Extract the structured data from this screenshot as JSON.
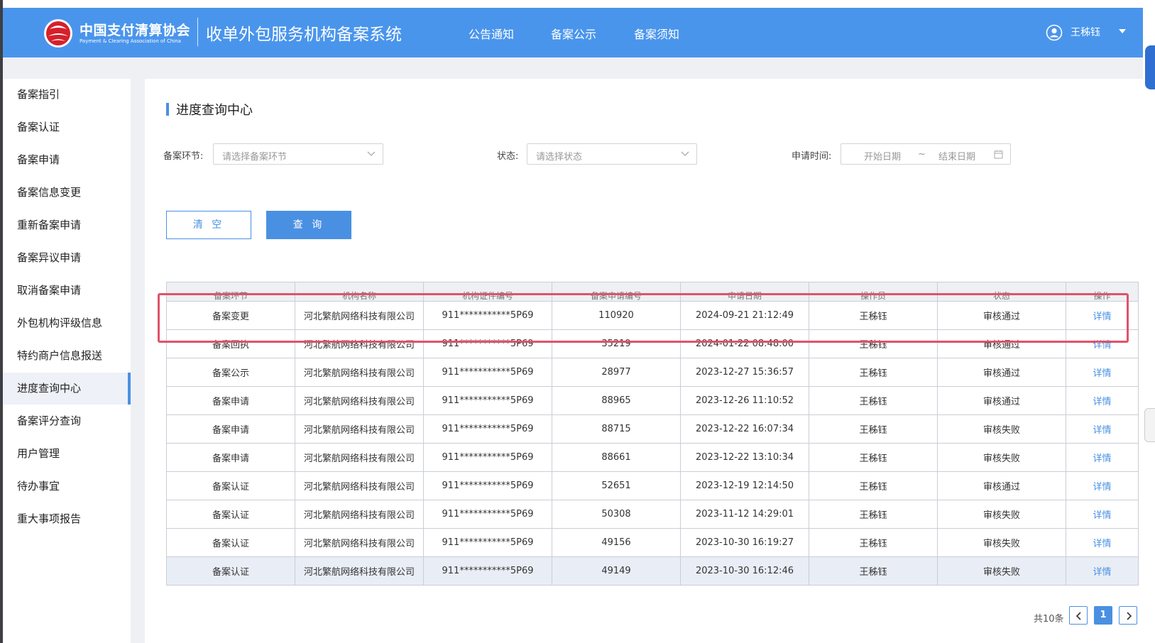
{
  "header": {
    "org_name_cn": "中国支付清算协会",
    "org_name_en": "Payment & Clearing Association of China",
    "system_title": "收单外包服务机构备案系统",
    "nav": [
      {
        "label": "公告通知"
      },
      {
        "label": "备案公示"
      },
      {
        "label": "备案须知"
      }
    ],
    "user_name": "王秭钰"
  },
  "sidebar": {
    "items": [
      {
        "label": "备案指引"
      },
      {
        "label": "备案认证"
      },
      {
        "label": "备案申请"
      },
      {
        "label": "备案信息变更"
      },
      {
        "label": "重新备案申请"
      },
      {
        "label": "备案异议申请"
      },
      {
        "label": "取消备案申请"
      },
      {
        "label": "外包机构评级信息"
      },
      {
        "label": "特约商户信息报送"
      },
      {
        "label": "进度查询中心"
      },
      {
        "label": "备案评分查询"
      },
      {
        "label": "用户管理"
      },
      {
        "label": "待办事宜"
      },
      {
        "label": "重大事项报告"
      }
    ],
    "active_item": "进度查询中心"
  },
  "main": {
    "title": "进度查询中心",
    "filters": {
      "stage_label": "备案环节:",
      "stage_placeholder": "请选择备案环节",
      "status_label": "状态:",
      "status_placeholder": "请选择状态",
      "date_label": "申请时间:",
      "start_placeholder": "开始日期",
      "range_sep": "~",
      "end_placeholder": "结束日期"
    },
    "buttons": {
      "clear": "清 空",
      "query": "查 询"
    },
    "table": {
      "headers": [
        "备案环节",
        "机构名称",
        "机构证件编号",
        "备案申请编号",
        "申请日期",
        "操作员",
        "状态",
        "操作"
      ],
      "rows": [
        [
          "备案变更",
          "河北繁航网络科技有限公司",
          "911***********5P69",
          "110920",
          "2024-09-21 21:12:49",
          "王秭钰",
          "审核通过",
          "详情"
        ],
        [
          "备案回执",
          "河北繁航网络科技有限公司",
          "911***********5P69",
          "35219",
          "2024-01-22 08:48:00",
          "王秭钰",
          "审核通过",
          "详情"
        ],
        [
          "备案公示",
          "河北繁航网络科技有限公司",
          "911***********5P69",
          "28977",
          "2023-12-27 15:36:57",
          "王秭钰",
          "审核通过",
          "详情"
        ],
        [
          "备案申请",
          "河北繁航网络科技有限公司",
          "911***********5P69",
          "88965",
          "2023-12-26 11:10:52",
          "王秭钰",
          "审核通过",
          "详情"
        ],
        [
          "备案申请",
          "河北繁航网络科技有限公司",
          "911***********5P69",
          "88715",
          "2023-12-22 16:07:34",
          "王秭钰",
          "审核失败",
          "详情"
        ],
        [
          "备案申请",
          "河北繁航网络科技有限公司",
          "911***********5P69",
          "88661",
          "2023-12-22 13:10:34",
          "王秭钰",
          "审核失败",
          "详情"
        ],
        [
          "备案认证",
          "河北繁航网络科技有限公司",
          "911***********5P69",
          "52651",
          "2023-12-19 12:14:50",
          "王秭钰",
          "审核通过",
          "详情"
        ],
        [
          "备案认证",
          "河北繁航网络科技有限公司",
          "911***********5P69",
          "50308",
          "2023-11-12 14:29:01",
          "王秭钰",
          "审核失败",
          "详情"
        ],
        [
          "备案认证",
          "河北繁航网络科技有限公司",
          "911***********5P69",
          "49156",
          "2023-10-30 16:19:27",
          "王秭钰",
          "审核失败",
          "详情"
        ],
        [
          "备案认证",
          "河北繁航网络科技有限公司",
          "911***********5P69",
          "49149",
          "2023-10-30 16:12:46",
          "王秭钰",
          "审核失败",
          "详情"
        ]
      ]
    },
    "pagination": {
      "total": "共10条",
      "current_page": "1"
    }
  },
  "colors": {
    "header_bg": "#4a95ec",
    "accent": "#4a90e2",
    "highlight_border": "#e0526a"
  },
  "icons": {
    "logo": "pcac-logo-icon",
    "user": "user-circle-icon",
    "caret": "caret-down-icon",
    "select_chevron": "chevron-down-icon",
    "calendar": "calendar-icon",
    "prev": "chevron-left-icon",
    "next": "chevron-right-icon"
  }
}
